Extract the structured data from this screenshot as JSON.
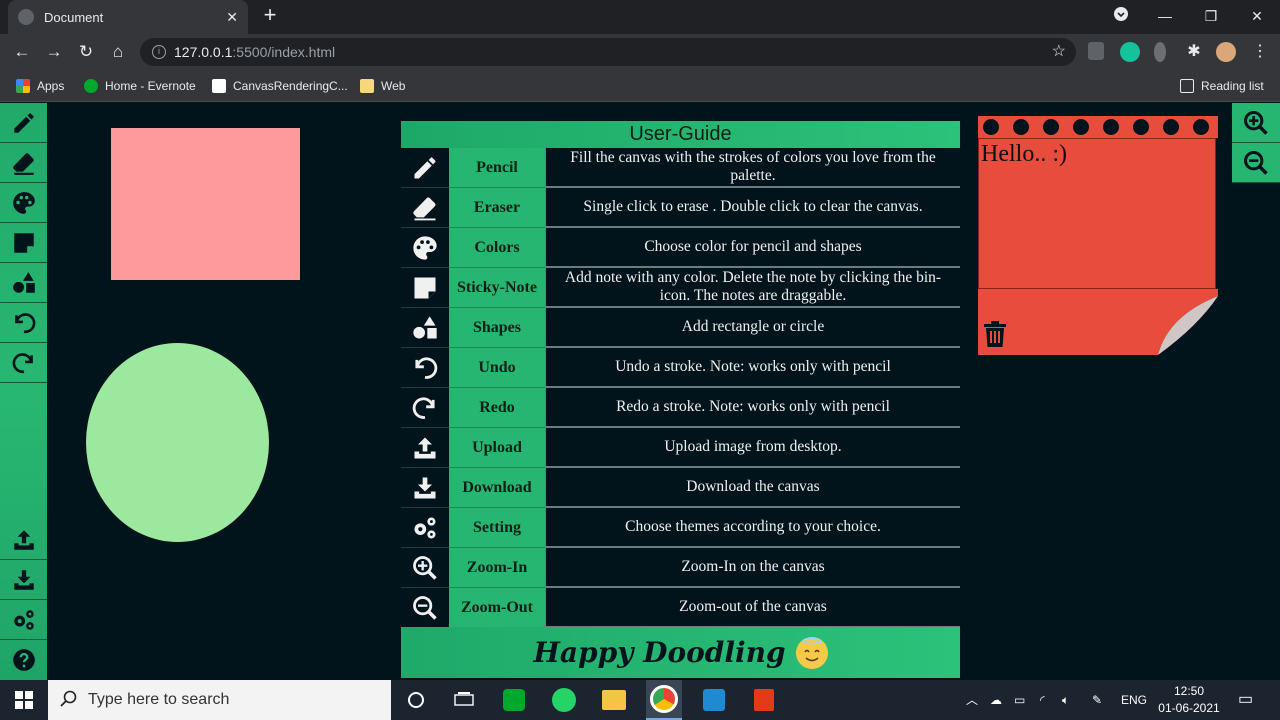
{
  "browser": {
    "tab_title": "Document",
    "new_tab": "+",
    "url_host": "127.0.0.1",
    "url_path": ":5500/index.html",
    "bookmarks": [
      "Apps",
      "Home - Evernote",
      "CanvasRenderingC...",
      "Web"
    ],
    "reading_list": "Reading list"
  },
  "guide": {
    "title": "User-Guide",
    "rows": [
      {
        "name": "Pencil",
        "desc": "Fill the canvas with the strokes of colors you love from the palette.",
        "icon": "pencil-icon"
      },
      {
        "name": "Eraser",
        "desc": "Single click to erase . Double click to clear the canvas.",
        "icon": "eraser-icon"
      },
      {
        "name": "Colors",
        "desc": "Choose color for pencil and shapes",
        "icon": "palette-icon"
      },
      {
        "name": "Sticky-Note",
        "desc": "Add note with any color. Delete the note by clicking the bin-icon. The notes are draggable.",
        "icon": "sticky-note-icon"
      },
      {
        "name": "Shapes",
        "desc": "Add rectangle or circle",
        "icon": "shapes-icon"
      },
      {
        "name": "Undo",
        "desc": "Undo a stroke. Note: works only with pencil",
        "icon": "undo-icon"
      },
      {
        "name": "Redo",
        "desc": "Redo a stroke. Note: works only with pencil",
        "icon": "redo-icon"
      },
      {
        "name": "Upload",
        "desc": "Upload image from desktop.",
        "icon": "upload-icon"
      },
      {
        "name": "Download",
        "desc": "Download the canvas",
        "icon": "download-icon"
      },
      {
        "name": "Setting",
        "desc": "Choose themes according to your choice.",
        "icon": "gears-icon"
      },
      {
        "name": "Zoom-In",
        "desc": "Zoom-In on the canvas",
        "icon": "zoom-in-icon"
      },
      {
        "name": "Zoom-Out",
        "desc": "Zoom-out of the canvas",
        "icon": "zoom-out-icon"
      }
    ],
    "footer": "Happy Doodling"
  },
  "sticky": {
    "text": "Hello.. :)",
    "color": "#e74c3c"
  },
  "colors": {
    "accent": "#27b572",
    "background": "#02141b",
    "rect": "#ff9a9c",
    "circle": "#9ce89e"
  },
  "taskbar": {
    "search_placeholder": "Type here to search",
    "lang": "ENG",
    "time": "12:50",
    "date": "01-06-2021"
  }
}
